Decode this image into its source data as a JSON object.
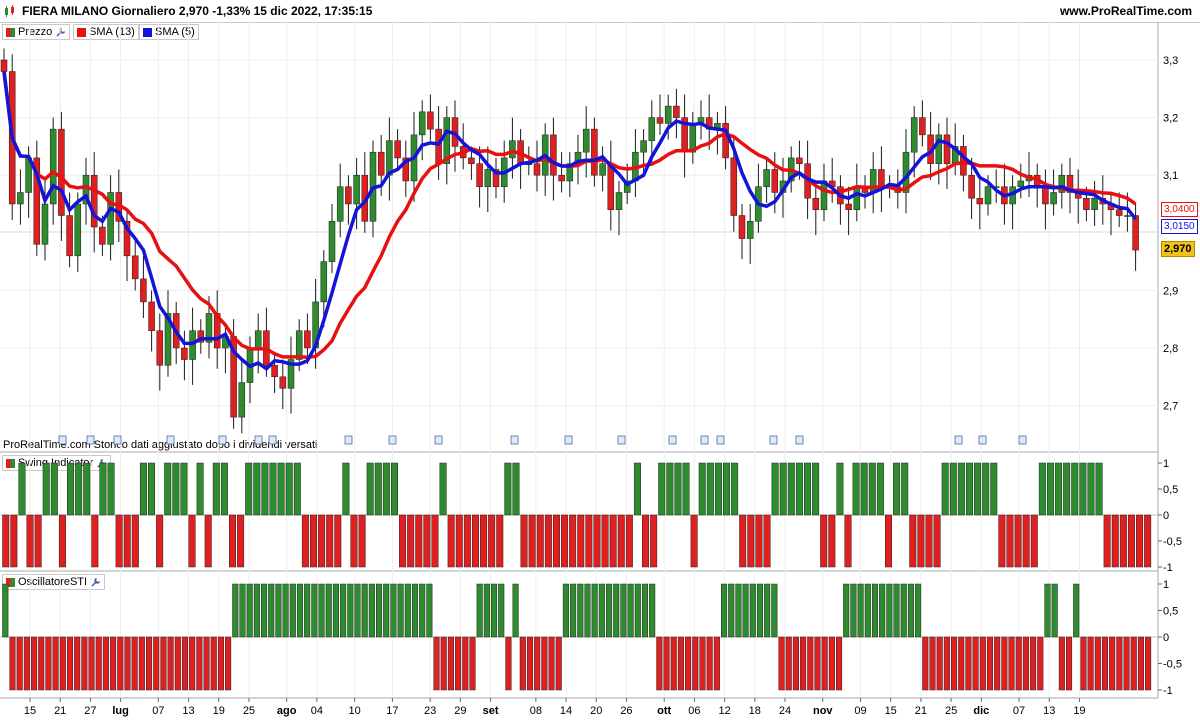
{
  "header": {
    "title": "FIERA MILANO Giornaliero 2,970 -1,33% 15 dic 2022, 17:35:15",
    "site": "www.ProRealTime.com"
  },
  "legends": {
    "price": "Prezzo",
    "sma13": "SMA (13)",
    "sma5": "SMA (5)",
    "swing": "Swing Indicator",
    "sti": "OscillatoreSTI"
  },
  "note": "ProRealTime.com Storico dati aggiustato dopo i dividendi versati",
  "tags": {
    "sma13": "3,0400",
    "sma5": "3,0150",
    "last": "2,970"
  },
  "colors": {
    "up": "#2e8b2e",
    "down": "#e02020",
    "sma13": "#e81010",
    "sma5": "#1414d8",
    "last_bg": "#f2c21b"
  },
  "chart_data": [
    {
      "type": "candlestick",
      "title": "FIERA MILANO Giornaliero",
      "y_ticks": [
        "3,3",
        "3,2",
        "3,1",
        "2,9",
        "2,8",
        "2,7"
      ],
      "y_tick_values": [
        3.3,
        3.2,
        3.1,
        2.9,
        2.8,
        2.7
      ],
      "ylim": [
        2.65,
        3.34
      ],
      "x_labels": [
        "15",
        "21",
        "27",
        "lug",
        "07",
        "13",
        "19",
        "25",
        "ago",
        "04",
        "10",
        "17",
        "23",
        "29",
        "set",
        "08",
        "14",
        "20",
        "26",
        "ott",
        "06",
        "12",
        "18",
        "24",
        "nov",
        "09",
        "15",
        "21",
        "25",
        "dic",
        "07",
        "13",
        "19"
      ],
      "x_label_days": [
        0,
        4,
        8,
        12,
        17,
        21,
        25,
        29,
        34,
        38,
        43,
        48,
        53,
        57,
        61,
        67,
        71,
        75,
        79,
        84,
        88,
        92,
        96,
        100,
        105,
        110,
        114,
        118,
        122,
        126,
        131,
        135,
        139
      ],
      "close_series": [
        3.28,
        3.05,
        3.07,
        3.13,
        2.98,
        3.05,
        3.18,
        3.03,
        2.96,
        3.05,
        3.1,
        3.01,
        2.98,
        3.07,
        3.02,
        2.96,
        2.92,
        2.88,
        2.83,
        2.77,
        2.86,
        2.8,
        2.78,
        2.83,
        2.81,
        2.86,
        2.8,
        2.82,
        2.68,
        2.74,
        2.8,
        2.83,
        2.77,
        2.75,
        2.73,
        2.78,
        2.83,
        2.8,
        2.88,
        2.95,
        3.02,
        3.08,
        3.05,
        3.1,
        3.02,
        3.14,
        3.1,
        3.16,
        3.13,
        3.09,
        3.17,
        3.21,
        3.18,
        3.12,
        3.2,
        3.15,
        3.13,
        3.12,
        3.08,
        3.11,
        3.08,
        3.13,
        3.16,
        3.12,
        3.12,
        3.1,
        3.17,
        3.1,
        3.09,
        3.12,
        3.14,
        3.18,
        3.1,
        3.12,
        3.04,
        3.07,
        3.09,
        3.14,
        3.16,
        3.2,
        3.19,
        3.22,
        3.2,
        3.14,
        3.19,
        3.2,
        3.18,
        3.19,
        3.13,
        3.03,
        2.99,
        3.02,
        3.08,
        3.11,
        3.07,
        3.09,
        3.13,
        3.12,
        3.06,
        3.04,
        3.09,
        3.08,
        3.05,
        3.04,
        3.08,
        3.07,
        3.11,
        3.08,
        3.08,
        3.07,
        3.14,
        3.2,
        3.17,
        3.12,
        3.17,
        3.12,
        3.15,
        3.1,
        3.06,
        3.05,
        3.08,
        3.08,
        3.05,
        3.08,
        3.09,
        3.1,
        3.08,
        3.05,
        3.07,
        3.1,
        3.07,
        3.06,
        3.04,
        3.06,
        3.05,
        3.04,
        3.03,
        3.03,
        2.97
      ],
      "series": [
        {
          "name": "Prezzo"
        },
        {
          "name": "SMA (13)",
          "last": 3.04
        },
        {
          "name": "SMA (5)",
          "last": 3.015
        }
      ],
      "last_price": 2.97
    },
    {
      "type": "bar",
      "title": "Swing Indicator",
      "y_ticks": [
        "1",
        "0,5",
        "0",
        "-0,5",
        "-1"
      ],
      "ylim": [
        -1,
        1
      ],
      "values": [
        -1,
        -1,
        1,
        -1,
        -1,
        1,
        1,
        -1,
        1,
        1,
        1,
        -1,
        1,
        1,
        -1,
        -1,
        -1,
        1,
        1,
        -1,
        1,
        1,
        1,
        -1,
        1,
        -1,
        1,
        1,
        -1,
        -1,
        1,
        1,
        1,
        1,
        1,
        1,
        1,
        -1,
        -1,
        -1,
        -1,
        -1,
        1,
        -1,
        -1,
        1,
        1,
        1,
        1,
        -1,
        -1,
        -1,
        -1,
        -1,
        1,
        -1,
        -1,
        -1,
        -1,
        -1,
        -1,
        -1,
        1,
        1,
        -1,
        -1,
        -1,
        -1,
        -1,
        -1,
        -1,
        -1,
        -1,
        -1,
        -1,
        -1,
        -1,
        -1,
        1,
        -1,
        -1,
        1,
        1,
        1,
        1,
        -1,
        1,
        1,
        1,
        1,
        1,
        -1,
        -1,
        -1,
        -1,
        1,
        1,
        1,
        1,
        1,
        1,
        -1,
        -1,
        1,
        -1,
        1,
        1,
        1,
        1,
        -1,
        1,
        1,
        -1,
        -1,
        -1,
        -1,
        1,
        1,
        1,
        1,
        1,
        1,
        1,
        -1,
        -1,
        -1,
        -1,
        -1,
        1,
        1,
        1,
        1,
        1,
        1,
        1,
        1,
        -1,
        -1,
        -1,
        -1,
        -1,
        -1
      ]
    },
    {
      "type": "bar",
      "title": "OscillatoreSTI",
      "y_ticks": [
        "1",
        "0,5",
        "0",
        "-0,5",
        "-1"
      ],
      "ylim": [
        -1,
        1
      ],
      "values": [
        1,
        -1,
        -1,
        -1,
        -1,
        -1,
        -1,
        -1,
        -1,
        -1,
        -1,
        -1,
        -1,
        -1,
        -1,
        -1,
        -1,
        -1,
        -1,
        -1,
        -1,
        -1,
        -1,
        -1,
        -1,
        -1,
        -1,
        -1,
        -1,
        -1,
        -1,
        -1,
        1,
        1,
        1,
        1,
        1,
        1,
        1,
        1,
        1,
        1,
        1,
        1,
        1,
        1,
        1,
        1,
        1,
        1,
        1,
        1,
        1,
        1,
        1,
        1,
        1,
        1,
        1,
        1,
        -1,
        -1,
        -1,
        -1,
        -1,
        -1,
        1,
        1,
        1,
        1,
        -1,
        1,
        -1,
        -1,
        -1,
        -1,
        -1,
        -1,
        1,
        1,
        1,
        1,
        1,
        1,
        1,
        1,
        1,
        1,
        1,
        1,
        1,
        -1,
        -1,
        -1,
        -1,
        -1,
        -1,
        -1,
        -1,
        -1,
        1,
        1,
        1,
        1,
        1,
        1,
        1,
        1,
        -1,
        -1,
        -1,
        -1,
        -1,
        -1,
        -1,
        -1,
        -1,
        1,
        1,
        1,
        1,
        1,
        1,
        1,
        1,
        1,
        1,
        1,
        -1,
        -1,
        -1,
        -1,
        -1,
        -1,
        -1,
        -1,
        -1,
        -1,
        -1,
        -1,
        -1,
        -1,
        -1,
        -1,
        -1,
        1,
        1,
        -1,
        -1,
        1,
        -1,
        -1,
        -1,
        -1,
        -1,
        -1,
        -1,
        -1,
        -1,
        -1
      ]
    }
  ]
}
